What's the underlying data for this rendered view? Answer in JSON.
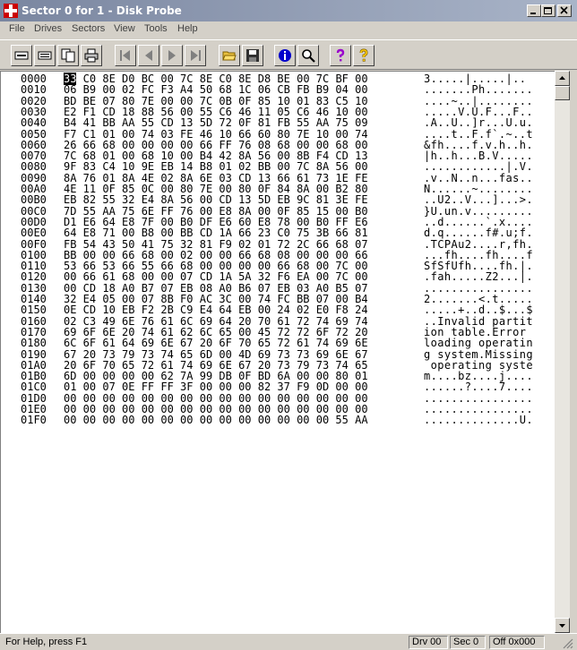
{
  "window": {
    "title": "Sector 0 for 1 - Disk Probe"
  },
  "menu": [
    "File",
    "Drives",
    "Sectors",
    "View",
    "Tools",
    "Help"
  ],
  "toolbar": [
    {
      "name": "read-sector-button",
      "icon": "read-sector-icon"
    },
    {
      "name": "read-next-button",
      "icon": "drive-icon"
    },
    {
      "name": "copy-button",
      "icon": "copy-icon"
    },
    {
      "name": "print-button",
      "icon": "print-icon"
    },
    {
      "name": "first-sector-button",
      "icon": "first-sector-icon"
    },
    {
      "name": "previous-sector-button",
      "icon": "previous-sector-icon"
    },
    {
      "name": "next-sector-button",
      "icon": "next-sector-icon"
    },
    {
      "name": "last-sector-button",
      "icon": "last-sector-icon"
    },
    {
      "name": "open-button",
      "icon": "open-folder-icon"
    },
    {
      "name": "save-button",
      "icon": "save-icon"
    },
    {
      "name": "info-button",
      "icon": "info-icon"
    },
    {
      "name": "find-button",
      "icon": "magnifier-icon"
    },
    {
      "name": "help-button",
      "icon": "help-icon"
    },
    {
      "name": "context-help-button",
      "icon": "context-help-icon"
    }
  ],
  "hex_rows": [
    {
      "offset": "0000",
      "bytes": "33 C0 8E D0 BC 00 7C 8E C0 8E D8 BE 00 7C BF 00",
      "ascii": "3.....|.....|.."
    },
    {
      "offset": "0010",
      "bytes": "06 B9 00 02 FC F3 A4 50 68 1C 06 CB FB B9 04 00",
      "ascii": ".......Ph......."
    },
    {
      "offset": "0020",
      "bytes": "BD BE 07 80 7E 00 00 7C 0B 0F 85 10 01 83 C5 10",
      "ascii": "....~..|........"
    },
    {
      "offset": "0030",
      "bytes": "E2 F1 CD 18 88 56 00 55 C6 46 11 05 C6 46 10 00",
      "ascii": ".....V.U.F...F.."
    },
    {
      "offset": "0040",
      "bytes": "B4 41 BB AA 55 CD 13 5D 72 0F 81 FB 55 AA 75 09",
      "ascii": ".A..U..]r...U.u."
    },
    {
      "offset": "0050",
      "bytes": "F7 C1 01 00 74 03 FE 46 10 66 60 80 7E 10 00 74",
      "ascii": "....t..F.f`.~..t"
    },
    {
      "offset": "0060",
      "bytes": "26 66 68 00 00 00 00 66 FF 76 08 68 00 00 68 00",
      "ascii": "&fh....f.v.h..h."
    },
    {
      "offset": "0070",
      "bytes": "7C 68 01 00 68 10 00 B4 42 8A 56 00 8B F4 CD 13",
      "ascii": "|h..h...B.V....."
    },
    {
      "offset": "0080",
      "bytes": "9F 83 C4 10 9E EB 14 B8 01 02 BB 00 7C 8A 56 00",
      "ascii": "............|.V."
    },
    {
      "offset": "0090",
      "bytes": "8A 76 01 8A 4E 02 8A 6E 03 CD 13 66 61 73 1E FE",
      "ascii": ".v..N..n...fas.."
    },
    {
      "offset": "00A0",
      "bytes": "4E 11 0F 85 0C 00 80 7E 00 80 0F 84 8A 00 B2 80",
      "ascii": "N......~........"
    },
    {
      "offset": "00B0",
      "bytes": "EB 82 55 32 E4 8A 56 00 CD 13 5D EB 9C 81 3E FE",
      "ascii": "..U2..V...]...>."
    },
    {
      "offset": "00C0",
      "bytes": "7D 55 AA 75 6E FF 76 00 E8 8A 00 0F 85 15 00 B0",
      "ascii": "}U.un.v........."
    },
    {
      "offset": "00D0",
      "bytes": "D1 E6 64 E8 7F 00 B0 DF E6 60 E8 78 00 B0 FF E6",
      "ascii": "..d......`.x...."
    },
    {
      "offset": "00E0",
      "bytes": "64 E8 71 00 B8 00 BB CD 1A 66 23 C0 75 3B 66 81",
      "ascii": "d.q......f#.u;f."
    },
    {
      "offset": "00F0",
      "bytes": "FB 54 43 50 41 75 32 81 F9 02 01 72 2C 66 68 07",
      "ascii": ".TCPAu2....r,fh."
    },
    {
      "offset": "0100",
      "bytes": "BB 00 00 66 68 00 02 00 00 66 68 08 00 00 00 66",
      "ascii": "...fh....fh....f"
    },
    {
      "offset": "0110",
      "bytes": "53 66 53 66 55 66 68 00 00 00 00 66 68 00 7C 00",
      "ascii": "SfSfUfh....fh.|."
    },
    {
      "offset": "0120",
      "bytes": "00 66 61 68 00 00 07 CD 1A 5A 32 F6 EA 00 7C 00",
      "ascii": ".fah.....Z2...|."
    },
    {
      "offset": "0130",
      "bytes": "00 CD 18 A0 B7 07 EB 08 A0 B6 07 EB 03 A0 B5 07",
      "ascii": "................"
    },
    {
      "offset": "0140",
      "bytes": "32 E4 05 00 07 8B F0 AC 3C 00 74 FC BB 07 00 B4",
      "ascii": "2.......<.t....."
    },
    {
      "offset": "0150",
      "bytes": "0E CD 10 EB F2 2B C9 E4 64 EB 00 24 02 E0 F8 24",
      "ascii": ".....+..d..$...$"
    },
    {
      "offset": "0160",
      "bytes": "02 C3 49 6E 76 61 6C 69 64 20 70 61 72 74 69 74",
      "ascii": "..Invalid partit"
    },
    {
      "offset": "0170",
      "bytes": "69 6F 6E 20 74 61 62 6C 65 00 45 72 72 6F 72 20",
      "ascii": "ion table.Error "
    },
    {
      "offset": "0180",
      "bytes": "6C 6F 61 64 69 6E 67 20 6F 70 65 72 61 74 69 6E",
      "ascii": "loading operatin"
    },
    {
      "offset": "0190",
      "bytes": "67 20 73 79 73 74 65 6D 00 4D 69 73 73 69 6E 67",
      "ascii": "g system.Missing"
    },
    {
      "offset": "01A0",
      "bytes": "20 6F 70 65 72 61 74 69 6E 67 20 73 79 73 74 65",
      "ascii": " operating syste"
    },
    {
      "offset": "01B0",
      "bytes": "6D 00 00 00 00 62 7A 99 DB 0F BD 6A 00 00 80 01",
      "ascii": "m....bz....j...."
    },
    {
      "offset": "01C0",
      "bytes": "01 00 07 0E FF FF 3F 00 00 00 82 37 F9 0D 00 00",
      "ascii": "......?....7...."
    },
    {
      "offset": "01D0",
      "bytes": "00 00 00 00 00 00 00 00 00 00 00 00 00 00 00 00",
      "ascii": "................"
    },
    {
      "offset": "01E0",
      "bytes": "00 00 00 00 00 00 00 00 00 00 00 00 00 00 00 00",
      "ascii": "................"
    },
    {
      "offset": "01F0",
      "bytes": "00 00 00 00 00 00 00 00 00 00 00 00 00 00 55 AA",
      "ascii": "..............U."
    }
  ],
  "status": {
    "help": "For Help, press F1",
    "drive": "Drv 00",
    "sector": "Sec 0",
    "offset": "Off 0x000"
  },
  "colors": {
    "title_bar": "#7a86a0",
    "selection": "#000000",
    "info_icon": "#0000cc",
    "help_icon": "#9900cc",
    "context_help_icon": "#ffcc00"
  }
}
